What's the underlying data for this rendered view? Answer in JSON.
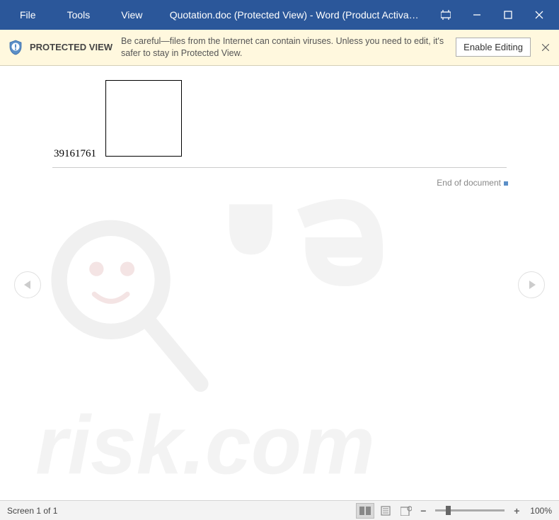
{
  "menu": {
    "file": "File",
    "tools": "Tools",
    "view": "View"
  },
  "title": "Quotation.doc (Protected View) - Word (Product Activa…",
  "banner": {
    "title": "PROTECTED VIEW",
    "message": "Be careful—files from the Internet can contain viruses. Unless you need to edit, it's safer to stay in Protected View.",
    "enable": "Enable Editing"
  },
  "document": {
    "number": "39161761",
    "end_label": "End of document"
  },
  "status": {
    "screen": "Screen 1 of 1",
    "zoom": "100%",
    "minus": "−",
    "plus": "+"
  },
  "colors": {
    "accent": "#2B579A",
    "banner_bg": "#FFF8DE"
  }
}
